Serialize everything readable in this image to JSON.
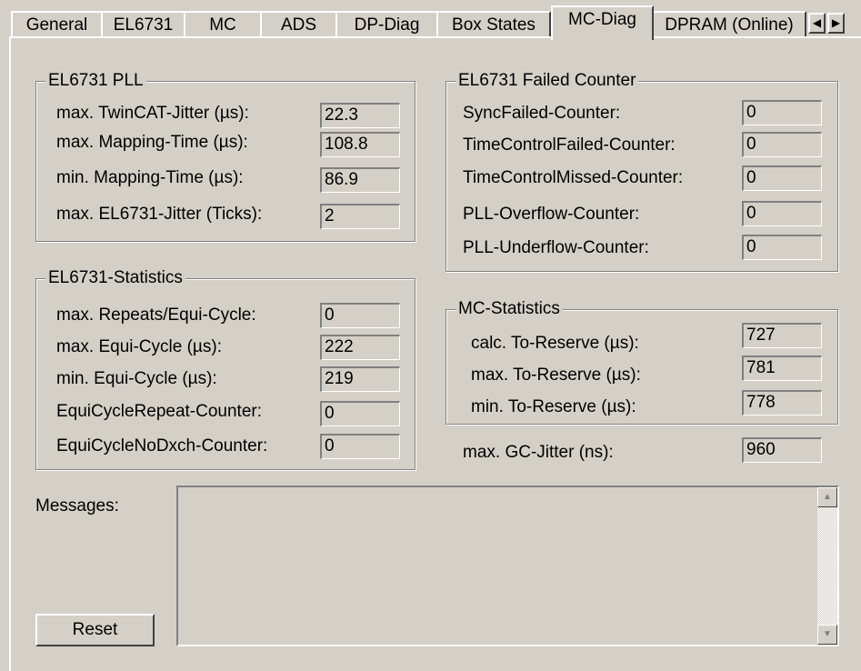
{
  "tabs": [
    {
      "label": "General"
    },
    {
      "label": "EL6731"
    },
    {
      "label": "MC"
    },
    {
      "label": "ADS"
    },
    {
      "label": "DP-Diag"
    },
    {
      "label": "Box States"
    },
    {
      "label": "MC-Diag"
    },
    {
      "label": "DPRAM (Online)"
    }
  ],
  "active_tab": "MC-Diag",
  "icons": {
    "tab_left": "arrow-left-icon",
    "tab_right": "arrow-right-icon",
    "scroll_up": "arrow-up-icon",
    "scroll_down": "arrow-down-icon"
  },
  "pll": {
    "title": "EL6731 PLL",
    "rows": [
      {
        "label": "max. TwinCAT-Jitter (µs):",
        "value": "22.3"
      },
      {
        "label": "max. Mapping-Time (µs):",
        "value": "108.8"
      },
      {
        "label": "min. Mapping-Time (µs):",
        "value": "86.9"
      },
      {
        "label": "max. EL6731-Jitter (Ticks):",
        "value": "2"
      }
    ]
  },
  "statistics": {
    "title": "EL6731-Statistics",
    "rows": [
      {
        "label": "max. Repeats/Equi-Cycle:",
        "value": "0"
      },
      {
        "label": "max. Equi-Cycle (µs):",
        "value": "222"
      },
      {
        "label": "min. Equi-Cycle (µs):",
        "value": "219"
      },
      {
        "label": "EquiCycleRepeat-Counter:",
        "value": "0"
      },
      {
        "label": "EquiCycleNoDxch-Counter:",
        "value": "0"
      }
    ]
  },
  "failed": {
    "title": "EL6731 Failed Counter",
    "rows": [
      {
        "label": "SyncFailed-Counter:",
        "value": "0"
      },
      {
        "label": "TimeControlFailed-Counter:",
        "value": "0"
      },
      {
        "label": "TimeControlMissed-Counter:",
        "value": "0"
      },
      {
        "label": "PLL-Overflow-Counter:",
        "value": "0"
      },
      {
        "label": "PLL-Underflow-Counter:",
        "value": "0"
      }
    ]
  },
  "mc_statistics": {
    "title": "MC-Statistics",
    "rows": [
      {
        "label": "calc. To-Reserve (µs):",
        "value": "727"
      },
      {
        "label": "max. To-Reserve (µs):",
        "value": "781"
      },
      {
        "label": "min. To-Reserve (µs):",
        "value": "778"
      }
    ]
  },
  "gc_jitter": {
    "label": "max. GC-Jitter (ns):",
    "value": "960"
  },
  "messages": {
    "label": "Messages:",
    "content": ""
  },
  "reset_label": "Reset"
}
